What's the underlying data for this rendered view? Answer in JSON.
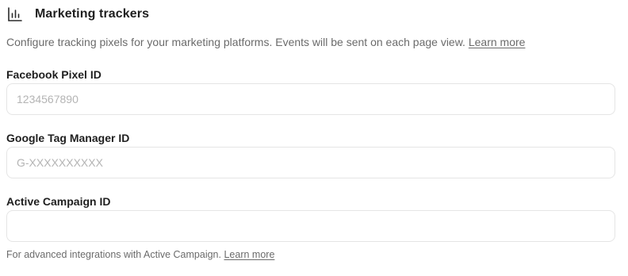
{
  "header": {
    "icon": "bar-chart-icon",
    "title": "Marketing trackers"
  },
  "description": {
    "text": "Configure tracking pixels for your marketing platforms. Events will be sent on each page view.",
    "link_label": "Learn more"
  },
  "fields": [
    {
      "label": "Facebook Pixel ID",
      "value": "",
      "placeholder": "1234567890"
    },
    {
      "label": "Google Tag Manager ID",
      "value": "",
      "placeholder": "G-XXXXXXXXXX"
    },
    {
      "label": "Active Campaign ID",
      "value": "",
      "placeholder": ""
    }
  ],
  "helper": {
    "text": "For advanced integrations with Active Campaign.",
    "link_label": "Learn more"
  },
  "colors": {
    "text_primary": "#1f1f1f",
    "text_muted": "#6b6b6b",
    "placeholder": "#b4b4b4",
    "border": "#e5e5e5"
  }
}
